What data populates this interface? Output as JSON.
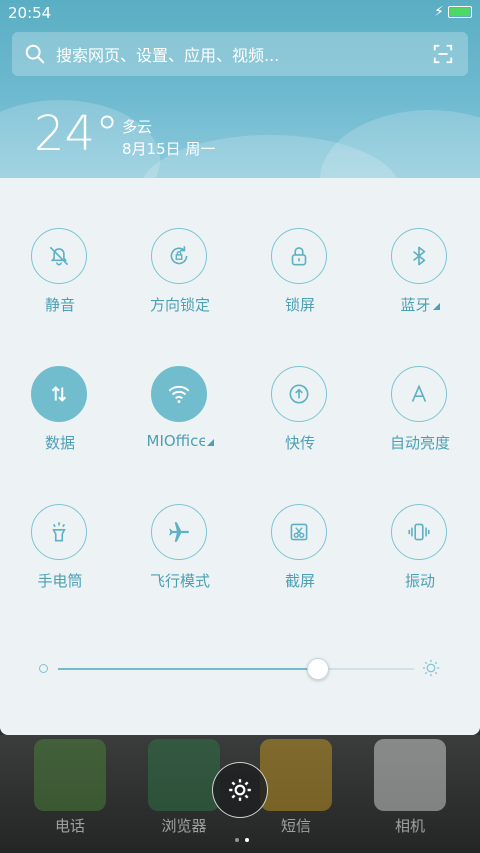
{
  "status_bar": {
    "time": "20:54"
  },
  "search": {
    "placeholder": "搜索网页、设置、应用、视频..."
  },
  "weather": {
    "temperature": "24°",
    "condition": "多云",
    "date": "8月15日 周一"
  },
  "toggles": [
    {
      "label": "静音",
      "icon": "bell-off-icon",
      "active": false
    },
    {
      "label": "方向锁定",
      "icon": "rotation-lock-icon",
      "active": false
    },
    {
      "label": "锁屏",
      "icon": "lock-icon",
      "active": false
    },
    {
      "label": "蓝牙",
      "icon": "bluetooth-icon",
      "active": false,
      "expandable": true
    },
    {
      "label": "数据",
      "icon": "data-arrows-icon",
      "active": true
    },
    {
      "label": "MIOffice",
      "icon": "wifi-icon",
      "active": true,
      "expandable": true
    },
    {
      "label": "快传",
      "icon": "upload-icon",
      "active": false
    },
    {
      "label": "自动亮度",
      "icon": "letter-a-icon",
      "active": false
    },
    {
      "label": "手电筒",
      "icon": "flashlight-icon",
      "active": false
    },
    {
      "label": "飞行模式",
      "icon": "airplane-icon",
      "active": false
    },
    {
      "label": "截屏",
      "icon": "screenshot-icon",
      "active": false
    },
    {
      "label": "振动",
      "icon": "vibrate-icon",
      "active": false
    }
  ],
  "brightness": {
    "level": 0.73
  },
  "dock": {
    "apps": [
      {
        "label": "电话",
        "color": "#4d8c3a"
      },
      {
        "label": "浏览器",
        "color": "#2e7d4a"
      },
      {
        "label": "短信",
        "color": "#d8a21e"
      },
      {
        "label": "相机",
        "color": "#e8e8e8"
      }
    ]
  },
  "colors": {
    "accent": "#72bdcd",
    "label": "#4d9fb3",
    "panel": "#edf3f5"
  }
}
